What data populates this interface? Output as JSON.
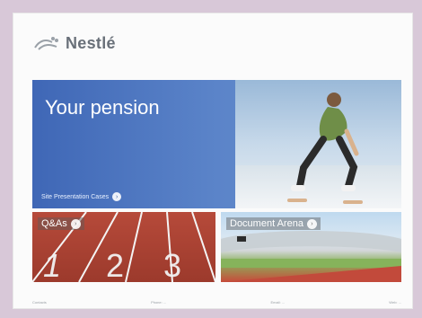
{
  "brand": {
    "logo_text": "Nestlé",
    "accent": "#4169B4",
    "text_color": "#697079"
  },
  "hero": {
    "title": "Your pension",
    "link_label": "Site Presentation Cases",
    "link_icon": "arrow-right-icon"
  },
  "tiles": [
    {
      "label": "Q&As",
      "icon": "arrow-right-icon"
    },
    {
      "label": "Document Arena",
      "icon": "arrow-right-icon"
    }
  ],
  "footer": {
    "items": [
      "Contacts",
      "Phone: ...",
      "Email: ...",
      "Web: ..."
    ]
  }
}
